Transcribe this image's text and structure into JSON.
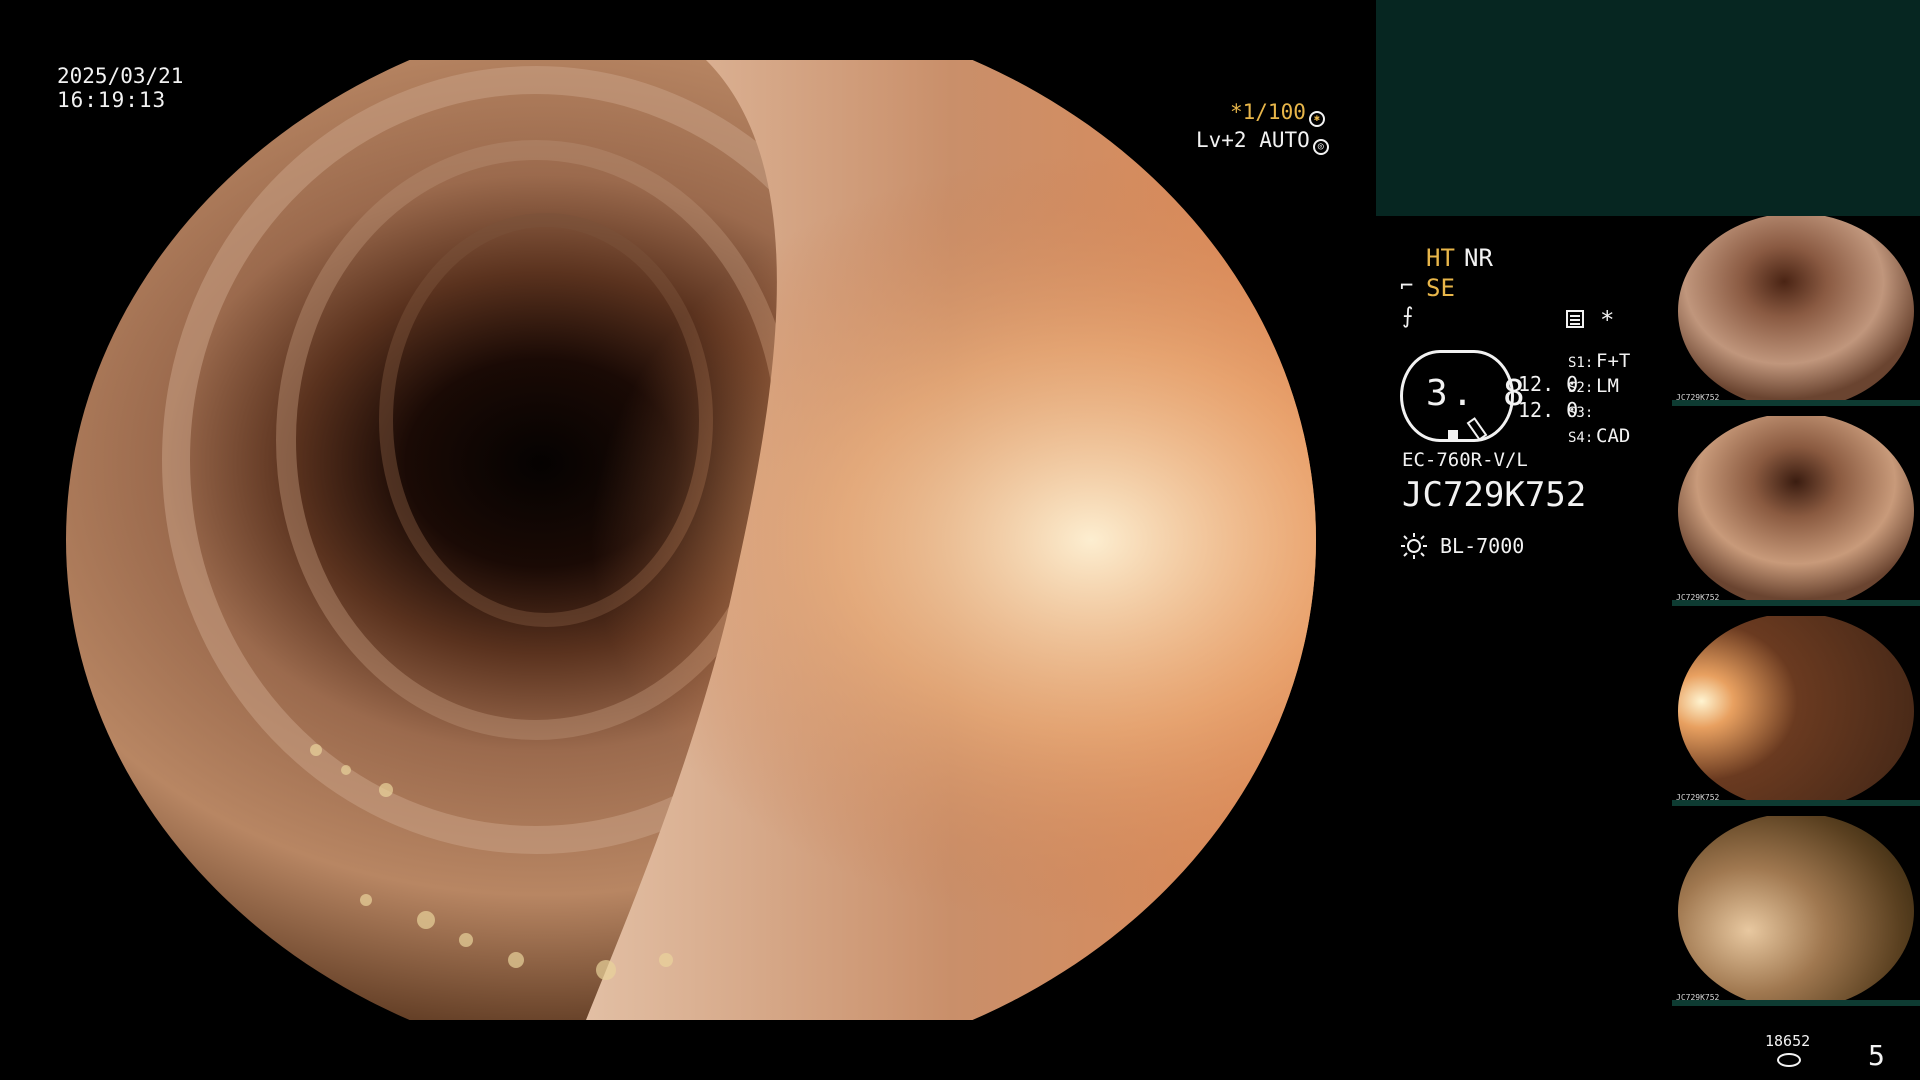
{
  "overlay": {
    "date": "2025/03/21",
    "time": "16:19:13",
    "shutter": "*1/100",
    "level": "Lv+2 AUTO"
  },
  "panel": {
    "mode_ht": "HT",
    "mode_nr": "NR",
    "mode_se": "SE",
    "star": "*",
    "gauge_value": "3. 8",
    "value1": "12. 0",
    "value2": "12. 0",
    "slots": [
      {
        "key": "S1:",
        "value": "F+T"
      },
      {
        "key": "S2:",
        "value": "LM"
      },
      {
        "key": "S3:",
        "value": ""
      },
      {
        "key": "S4:",
        "value": "CAD"
      }
    ],
    "scope_model": "EC-760R-V/L",
    "serial": "JC729K752",
    "light_source": "BL-7000"
  },
  "thumbnails": [
    {
      "label": "JC729K752"
    },
    {
      "label": "JC729K752"
    },
    {
      "label": "JC729K752"
    },
    {
      "label": "JC729K752"
    }
  ],
  "footer": {
    "image_count": "18652",
    "page": "5"
  },
  "colors": {
    "accent": "#e8b64a",
    "panel_teal": "#062621",
    "text": "#f2f2f2"
  },
  "icons": [
    "aperture-icon",
    "shutter-ring-icon",
    "scissors-icon",
    "flag-icon",
    "menu-icon",
    "sun-icon",
    "database-icon"
  ]
}
